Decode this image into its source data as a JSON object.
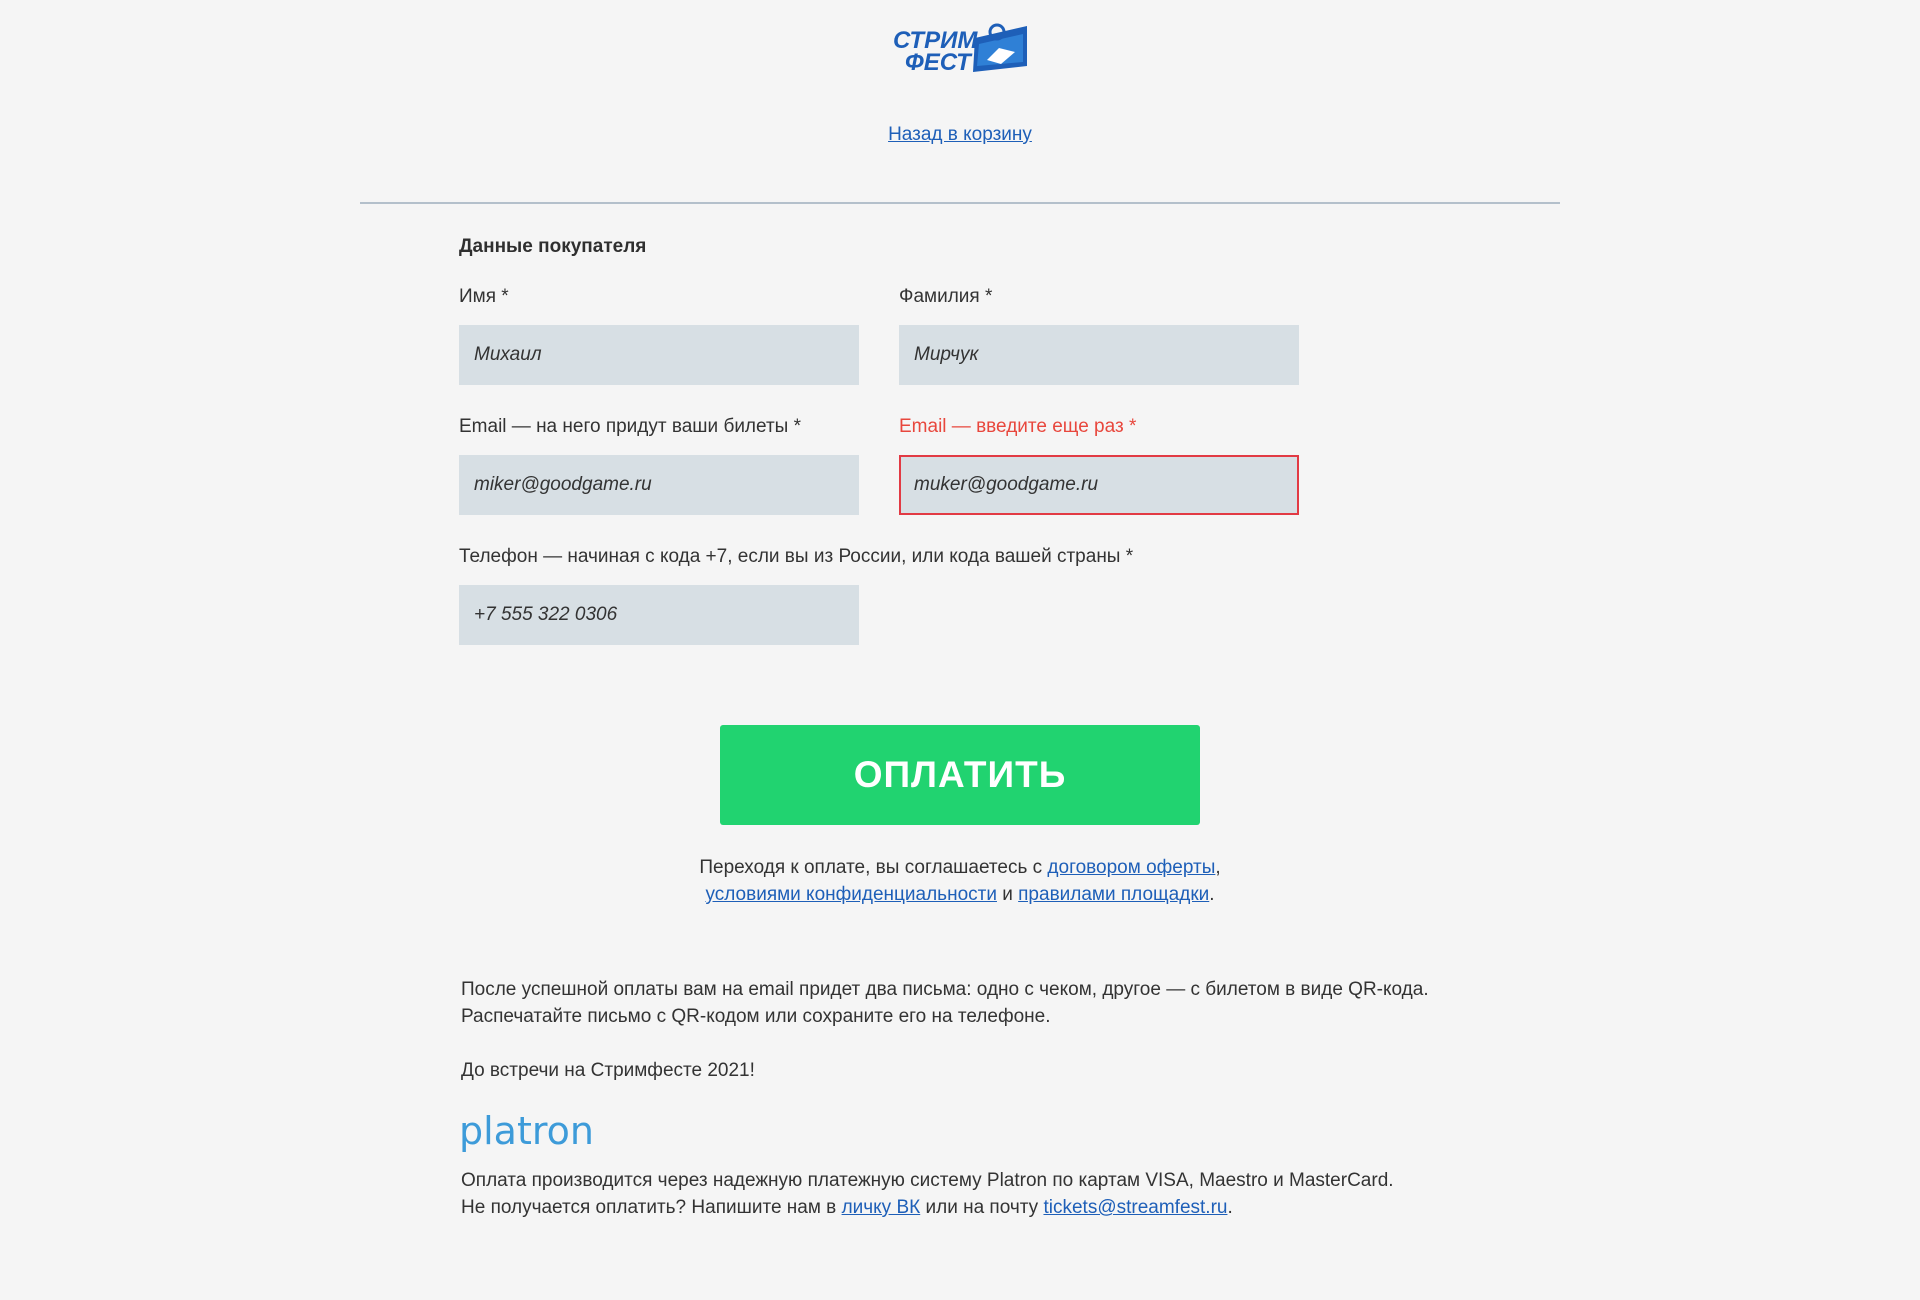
{
  "brand": {
    "logo_line1": "СТРИМ",
    "logo_line2": "ФЕСТ",
    "logo_color": "#1e5fb8"
  },
  "nav": {
    "back_to_cart": "Назад в корзину"
  },
  "form": {
    "section_title": "Данные покупателя",
    "first_name": {
      "label": "Имя *",
      "value": "Михаил"
    },
    "last_name": {
      "label": "Фамилия *",
      "value": "Мирчук"
    },
    "email": {
      "label": "Email — на него придут ваши билеты *",
      "value": "miker@goodgame.ru"
    },
    "email_confirm": {
      "label": "Email — введите еще раз *",
      "value": "muker@goodgame.ru",
      "state": "error"
    },
    "phone": {
      "label": "Телефон — начиная с кода +7, если вы из России, или кода вашей страны *",
      "value": "+7 555 322 0306"
    }
  },
  "pay": {
    "button_label": "ОПЛАТИТЬ",
    "button_color": "#21d370"
  },
  "agreement": {
    "prefix": "Переходя к оплате, вы соглашаетесь с ",
    "offer_link": "договором оферты",
    "comma": ",",
    "privacy_link": "условиями конфиденциальности",
    "and": " и ",
    "rules_link": "правилами площадки",
    "period": "."
  },
  "info": {
    "line1": "После успешной оплаты вам на email придет два письма: одно с чеком, другое — с билетом в виде QR-кода.",
    "line2": "Распечатайте письмо с QR-кодом или сохраните его на телефоне.",
    "farewell": "До встречи на Стримфесте 2021!"
  },
  "payment_provider": {
    "name": "platron",
    "color": "#3d9bd9",
    "line1": "Оплата производится через надежную платежную систему Platron по картам VISA, Maestro и MasterCard.",
    "line2_prefix": "Не получается оплатить? Напишите нам в ",
    "vk_link": "личку ВК",
    "line2_middle": " или на почту ",
    "email_link": "tickets@streamfest.ru",
    "line2_suffix": "."
  }
}
